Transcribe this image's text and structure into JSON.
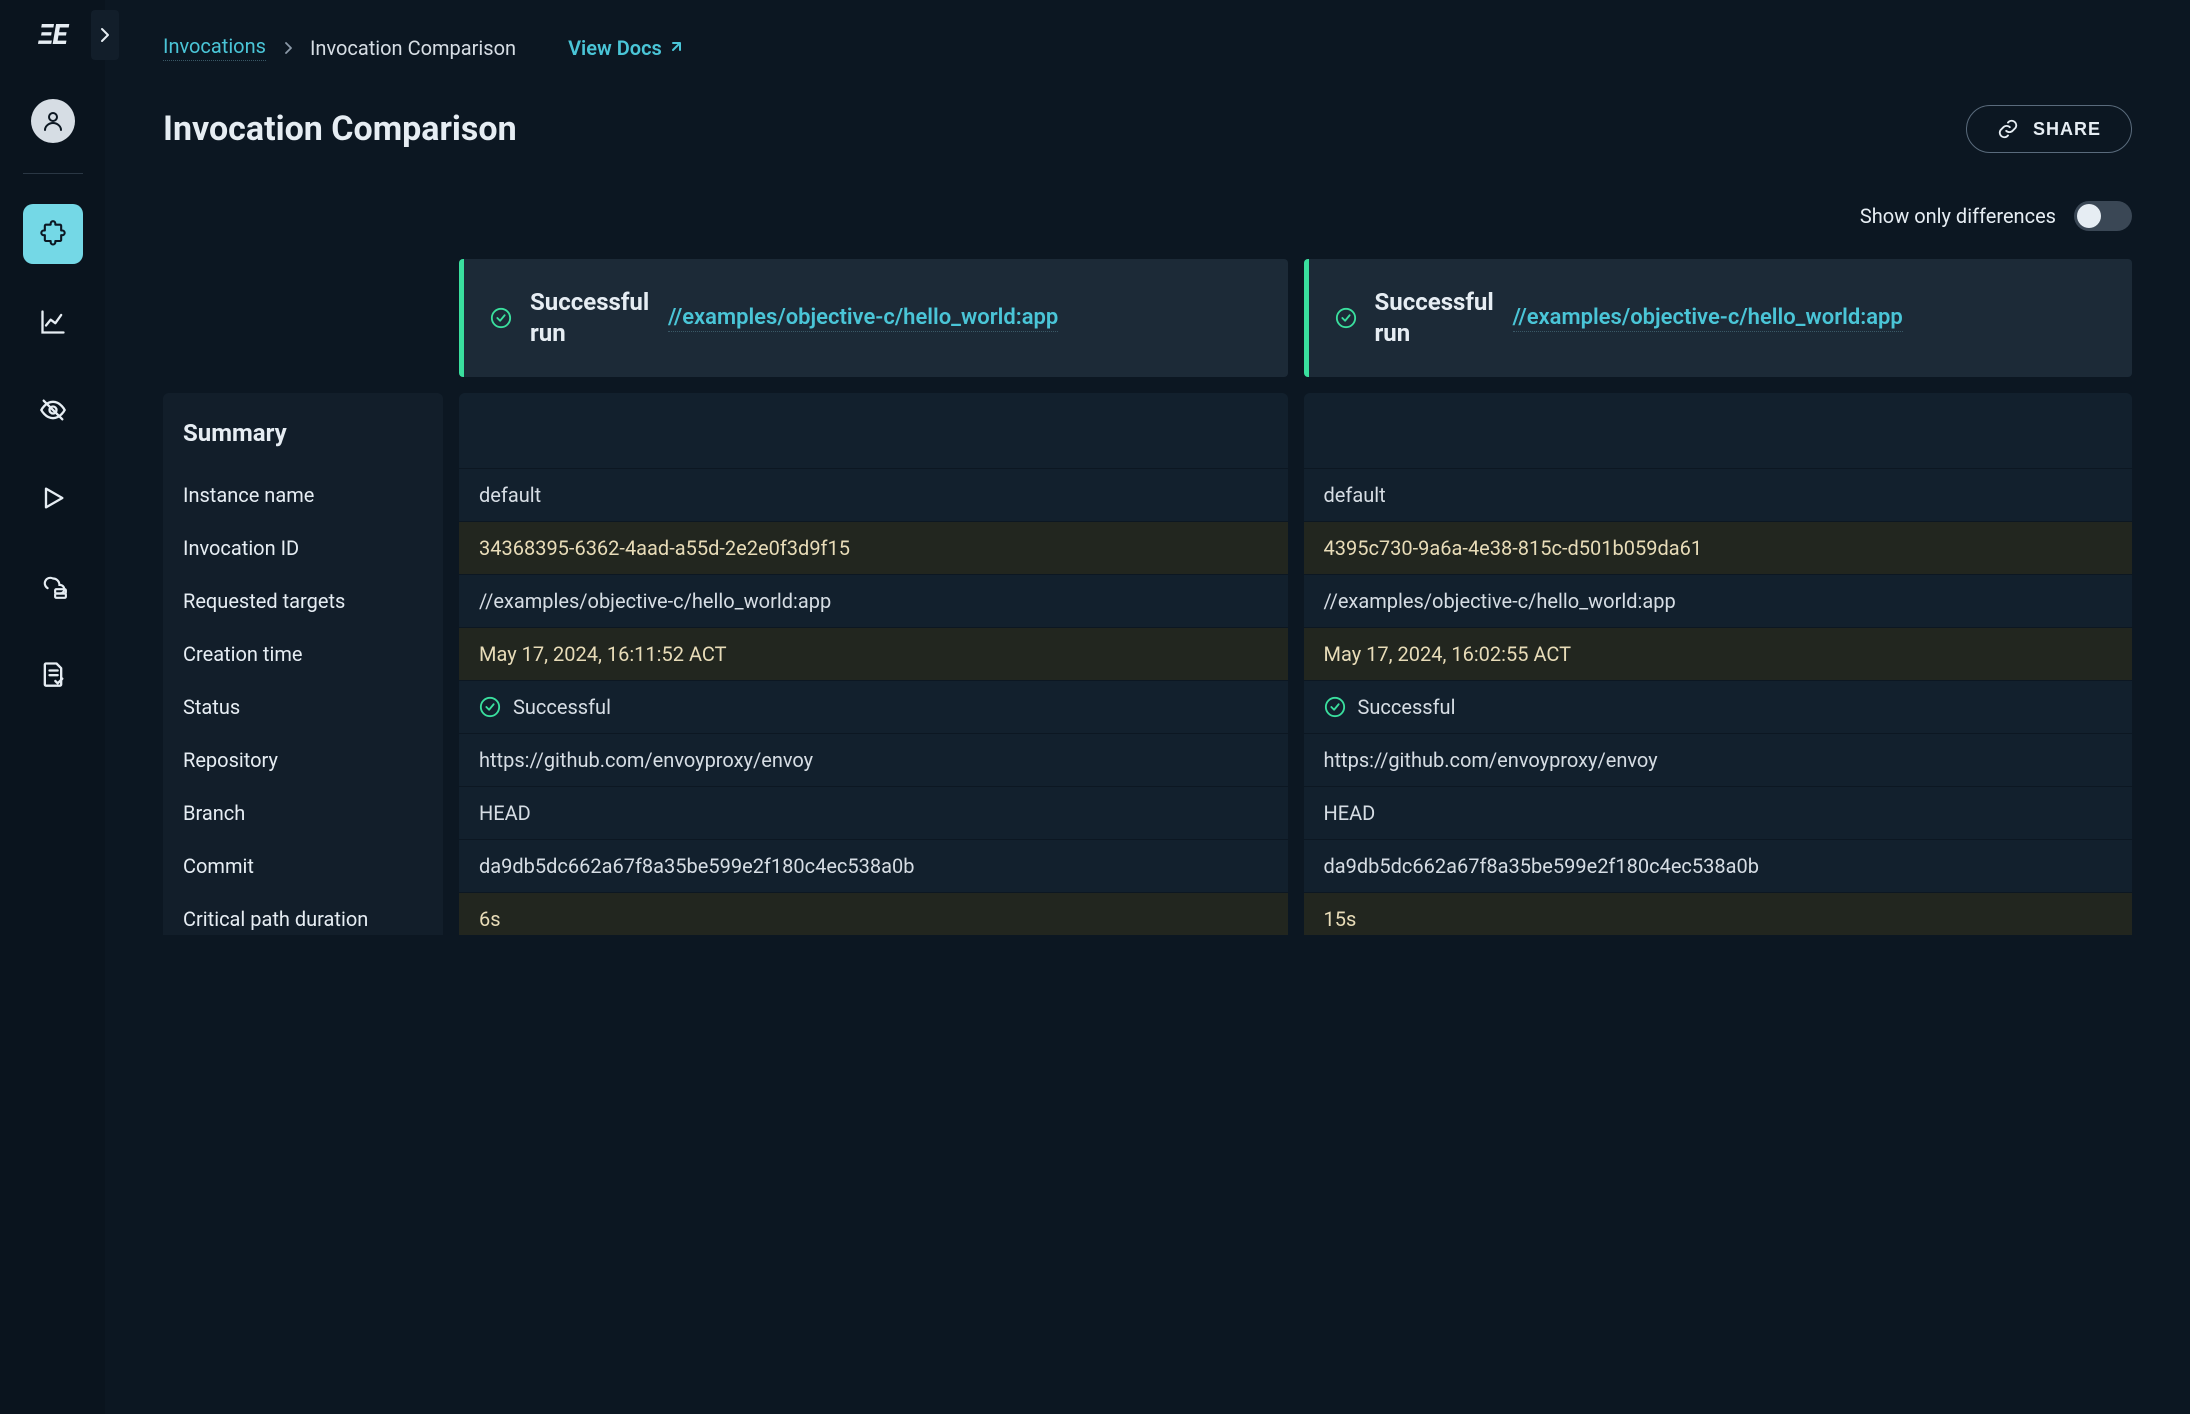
{
  "breadcrumb": {
    "root": "Invocations",
    "current": "Invocation Comparison",
    "docs": "View Docs"
  },
  "page_title": "Invocation Comparison",
  "share_label": "SHARE",
  "toggle_label": "Show only differences",
  "summary_heading": "Summary",
  "row_labels": [
    "Instance name",
    "Invocation ID",
    "Requested targets",
    "Creation time",
    "Status",
    "Repository",
    "Branch",
    "Commit",
    "Critical path duration"
  ],
  "runs": [
    {
      "status_text": "Successful run",
      "target": "//examples/objective-c/hello_world:app",
      "values": [
        {
          "text": "default",
          "diff": false
        },
        {
          "text": "34368395-6362-4aad-a55d-2e2e0f3d9f15",
          "diff": true
        },
        {
          "text": "//examples/objective-c/hello_world:app",
          "diff": false
        },
        {
          "text": "May 17, 2024, 16:11:52 ACT",
          "diff": true
        },
        {
          "text": "Successful",
          "diff": false,
          "status": true
        },
        {
          "text": "https://github.com/envoyproxy/envoy",
          "diff": false
        },
        {
          "text": "HEAD",
          "diff": false
        },
        {
          "text": "da9db5dc662a67f8a35be599e2f180c4ec538a0b",
          "diff": false
        },
        {
          "text": "6s",
          "diff": true
        }
      ]
    },
    {
      "status_text": "Successful run",
      "target": "//examples/objective-c/hello_world:app",
      "values": [
        {
          "text": "default",
          "diff": false
        },
        {
          "text": "4395c730-9a6a-4e38-815c-d501b059da61",
          "diff": true
        },
        {
          "text": "//examples/objective-c/hello_world:app",
          "diff": false
        },
        {
          "text": "May 17, 2024, 16:02:55 ACT",
          "diff": true
        },
        {
          "text": "Successful",
          "diff": false,
          "status": true
        },
        {
          "text": "https://github.com/envoyproxy/envoy",
          "diff": false
        },
        {
          "text": "HEAD",
          "diff": false
        },
        {
          "text": "da9db5dc662a67f8a35be599e2f180c4ec538a0b",
          "diff": false
        },
        {
          "text": "15s",
          "diff": true
        }
      ]
    }
  ]
}
